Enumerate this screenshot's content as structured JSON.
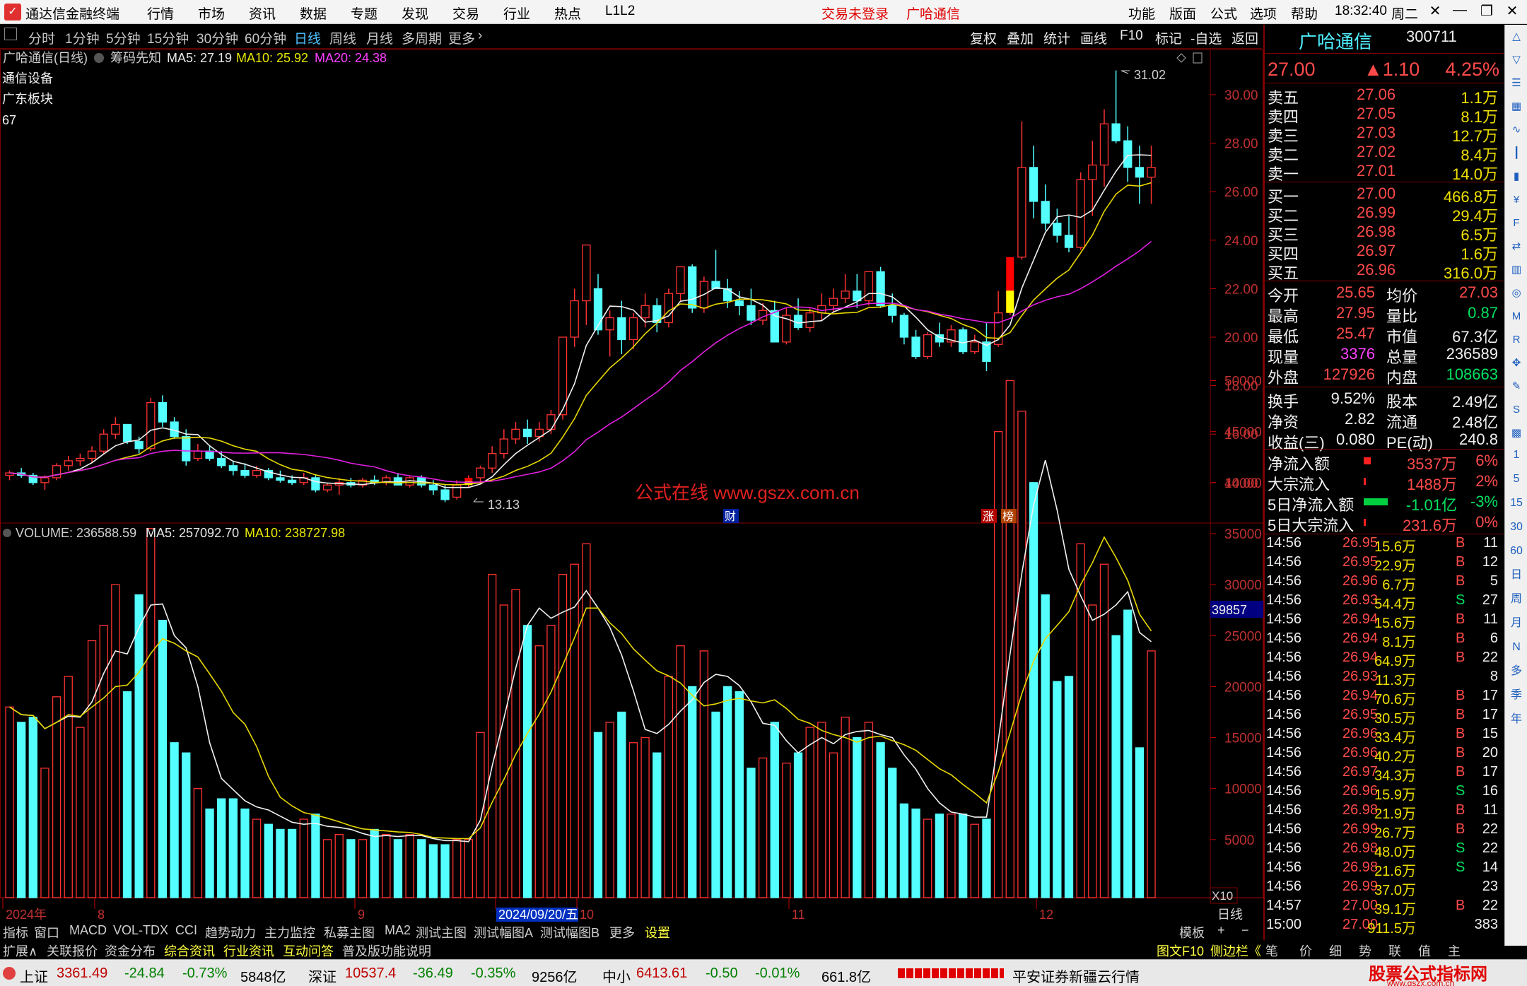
{
  "app": {
    "title": "通达信金融终端",
    "menus": [
      "行情",
      "市场",
      "资讯",
      "数据",
      "专题",
      "发现",
      "交易",
      "行业",
      "热点",
      "L1L2"
    ],
    "login": "交易未登录",
    "stock_tab": "广哈通信",
    "right_menus": [
      "功能",
      "版面",
      "公式",
      "选项",
      "帮助"
    ],
    "time": "18:32:40",
    "weekday": "周二"
  },
  "periods": [
    "分时",
    "1分钟",
    "5分钟",
    "15分钟",
    "30分钟",
    "60分钟",
    "日线",
    "周线",
    "月线",
    "多周期",
    "更多"
  ],
  "active_period": "日线",
  "tools": [
    "复权",
    "叠加",
    "统计",
    "画线",
    "F10",
    "标记",
    "-自选",
    "返回"
  ],
  "chart": {
    "title": "广哈通信(日线)",
    "chip": "筹码先知",
    "ma5": "MA5: 27.19",
    "ma10": "MA10: 25.92",
    "ma20": "MA20: 24.38",
    "info": [
      "通信设备",
      "广东板块",
      "67"
    ],
    "max_label": "31.02",
    "min_label": "13.13",
    "watermark": "公式在线 www.gszx.com.cn",
    "event_cai": "财",
    "event_zhang": "涨",
    "event_bang": "榜",
    "price_ticks": [
      "30.00",
      "28.00",
      "26.00",
      "24.00",
      "22.00",
      "20.00",
      "18.00",
      "16.00",
      "14.00"
    ]
  },
  "volume": {
    "title": "VOLUME: 236588.59",
    "ma5": "MA5: 257092.70",
    "ma10": "MA10: 238727.98",
    "ticks": [
      "50000",
      "45000",
      "40000",
      "35000",
      "30000",
      "25000",
      "20000",
      "15000",
      "10000",
      "5000"
    ],
    "cursor_value": "39857",
    "unit": "X10"
  },
  "xaxis": {
    "labels": [
      "2024年",
      "8",
      "9",
      "2024/09/20/五",
      "10",
      "11",
      "12"
    ],
    "period": "日线"
  },
  "chart_data": {
    "type": "candlestick",
    "series": [
      [
        14.3,
        14.5,
        14.1,
        14.4,
        18000
      ],
      [
        14.4,
        14.6,
        14.2,
        14.3,
        16500
      ],
      [
        14.3,
        14.4,
        13.9,
        14.0,
        17000
      ],
      [
        14.0,
        14.3,
        13.7,
        14.2,
        12000
      ],
      [
        14.2,
        14.8,
        14.1,
        14.7,
        19000
      ],
      [
        14.7,
        15.1,
        14.5,
        14.9,
        21000
      ],
      [
        14.9,
        15.2,
        14.7,
        15.0,
        16000
      ],
      [
        15.0,
        15.5,
        14.8,
        15.3,
        24500
      ],
      [
        15.3,
        16.2,
        15.2,
        16.0,
        26000
      ],
      [
        16.0,
        16.7,
        15.8,
        16.4,
        30000
      ],
      [
        16.4,
        16.1,
        15.6,
        15.7,
        19500
      ],
      [
        15.7,
        15.9,
        15.2,
        15.4,
        29000
      ],
      [
        15.4,
        17.5,
        15.3,
        17.3,
        35500
      ],
      [
        17.3,
        17.6,
        16.3,
        16.5,
        26500
      ],
      [
        16.5,
        16.7,
        15.8,
        15.9,
        14500
      ],
      [
        15.9,
        16.2,
        14.7,
        14.9,
        13500
      ],
      [
        15.0,
        15.6,
        14.9,
        15.3,
        10000
      ],
      [
        15.3,
        15.5,
        14.9,
        15.0,
        8000
      ],
      [
        15.0,
        15.3,
        14.6,
        14.7,
        9000
      ],
      [
        14.7,
        14.9,
        14.3,
        14.5,
        9000
      ],
      [
        14.5,
        14.8,
        14.2,
        14.3,
        8000
      ],
      [
        14.3,
        14.7,
        14.2,
        14.5,
        7000
      ],
      [
        14.5,
        14.6,
        14.1,
        14.2,
        6500
      ],
      [
        14.2,
        14.5,
        14.0,
        14.1,
        6000
      ],
      [
        14.1,
        14.3,
        13.9,
        14.0,
        6000
      ],
      [
        14.0,
        14.4,
        13.9,
        14.2,
        7000
      ],
      [
        14.2,
        14.3,
        13.6,
        13.7,
        7500
      ],
      [
        13.7,
        14.0,
        13.6,
        13.9,
        5000
      ],
      [
        13.9,
        14.2,
        13.5,
        14.0,
        5500
      ],
      [
        14.0,
        14.2,
        13.8,
        13.9,
        5000
      ],
      [
        13.9,
        14.2,
        13.8,
        14.1,
        5000
      ],
      [
        14.1,
        14.3,
        13.9,
        14.0,
        6000
      ],
      [
        14.0,
        14.3,
        13.9,
        14.2,
        5500
      ],
      [
        14.2,
        14.4,
        13.9,
        13.9,
        5000
      ],
      [
        13.9,
        14.3,
        13.8,
        14.2,
        5500
      ],
      [
        14.2,
        14.3,
        13.8,
        13.9,
        5000
      ],
      [
        13.9,
        14.1,
        13.5,
        13.7,
        4500
      ],
      [
        13.7,
        13.9,
        13.2,
        13.3,
        4500
      ],
      [
        13.4,
        14.1,
        13.3,
        13.9,
        5000
      ],
      [
        13.9,
        14.3,
        13.8,
        14.2,
        5000
      ],
      [
        14.2,
        14.7,
        14.0,
        14.6,
        15500
      ],
      [
        14.6,
        15.5,
        14.4,
        15.2,
        31000
      ],
      [
        15.2,
        16.2,
        15.0,
        15.8,
        28000
      ],
      [
        15.8,
        16.5,
        15.6,
        16.2,
        29500
      ],
      [
        16.2,
        16.6,
        15.6,
        15.9,
        26000
      ],
      [
        15.9,
        16.5,
        15.7,
        16.2,
        24000
      ],
      [
        16.2,
        17.0,
        16.0,
        16.8,
        26000
      ],
      [
        16.8,
        20.0,
        16.6,
        20.0,
        31000
      ],
      [
        20.0,
        22.0,
        19.6,
        21.5,
        32000
      ],
      [
        21.5,
        23.8,
        20.5,
        23.8,
        34000
      ],
      [
        22.0,
        22.6,
        20.1,
        20.3,
        15500
      ],
      [
        20.3,
        21.1,
        19.2,
        20.8,
        16500
      ],
      [
        20.8,
        21.5,
        19.3,
        19.9,
        17500
      ],
      [
        19.9,
        21.0,
        19.5,
        20.8,
        14500
      ],
      [
        20.8,
        21.8,
        20.4,
        21.3,
        15000
      ],
      [
        21.3,
        21.6,
        20.2,
        20.6,
        13500
      ],
      [
        20.6,
        22.0,
        20.4,
        21.8,
        21000
      ],
      [
        21.8,
        22.9,
        21.5,
        22.9,
        24000
      ],
      [
        22.9,
        23.0,
        21.0,
        21.2,
        20000
      ],
      [
        21.2,
        22.5,
        21.0,
        22.3,
        23500
      ],
      [
        22.3,
        23.6,
        22.0,
        22.0,
        17500
      ],
      [
        22.0,
        22.4,
        21.2,
        21.5,
        20000
      ],
      [
        21.5,
        21.9,
        20.9,
        21.3,
        19500
      ],
      [
        21.3,
        22.0,
        20.5,
        20.7,
        12000
      ],
      [
        20.7,
        21.4,
        20.5,
        21.1,
        13000
      ],
      [
        21.1,
        21.5,
        19.8,
        19.8,
        16500
      ],
      [
        19.8,
        21.2,
        19.7,
        20.9,
        12500
      ],
      [
        20.9,
        21.6,
        20.3,
        20.4,
        13500
      ],
      [
        20.4,
        21.2,
        20.2,
        21.0,
        16000
      ],
      [
        21.0,
        21.8,
        20.7,
        21.3,
        16500
      ],
      [
        21.3,
        22.0,
        21.0,
        21.6,
        13500
      ],
      [
        21.6,
        22.6,
        21.4,
        21.9,
        17000
      ],
      [
        21.9,
        22.6,
        21.2,
        21.5,
        15000
      ],
      [
        21.5,
        22.7,
        21.3,
        22.7,
        16500
      ],
      [
        22.7,
        22.9,
        21.2,
        21.3,
        14500
      ],
      [
        21.3,
        21.8,
        20.6,
        20.9,
        12000
      ],
      [
        20.9,
        21.0,
        19.7,
        20.0,
        8500
      ],
      [
        20.0,
        20.3,
        19.1,
        19.2,
        8000
      ],
      [
        19.2,
        20.2,
        19.1,
        20.1,
        7000
      ],
      [
        20.1,
        20.6,
        19.6,
        19.8,
        7500
      ],
      [
        19.8,
        20.5,
        19.6,
        20.3,
        7500
      ],
      [
        20.3,
        20.4,
        19.3,
        19.4,
        7500
      ],
      [
        19.4,
        20.1,
        19.3,
        19.8,
        6500
      ],
      [
        19.8,
        20.6,
        18.6,
        19.0,
        7000
      ],
      [
        19.7,
        21.9,
        19.6,
        21.0,
        45000
      ],
      [
        21.0,
        23.3,
        20.9,
        23.3,
        50000
      ],
      [
        23.3,
        28.9,
        23.2,
        27.0,
        47000
      ],
      [
        27.0,
        27.9,
        24.9,
        25.6,
        40000
      ],
      [
        25.6,
        26.3,
        24.4,
        24.7,
        29000
      ],
      [
        24.7,
        25.3,
        23.9,
        24.2,
        20500
      ],
      [
        24.2,
        25.0,
        23.5,
        23.7,
        21000
      ],
      [
        23.7,
        26.8,
        23.6,
        26.5,
        34000
      ],
      [
        26.5,
        28.1,
        25.0,
        27.1,
        28000
      ],
      [
        27.1,
        29.4,
        26.2,
        28.8,
        32000
      ],
      [
        28.8,
        31.0,
        28.0,
        28.1,
        25000
      ],
      [
        28.1,
        28.7,
        26.4,
        27.0,
        27500
      ],
      [
        27.0,
        27.9,
        25.5,
        26.6,
        14000
      ],
      [
        26.6,
        27.9,
        25.5,
        27.0,
        23500
      ]
    ]
  },
  "quote": {
    "name": "广哈通信",
    "code": "300711",
    "price": "27.00",
    "change": "▲1.10",
    "pct": "4.25%",
    "asks": [
      [
        "卖五",
        "27.06",
        "1.1万"
      ],
      [
        "卖四",
        "27.05",
        "8.1万"
      ],
      [
        "卖三",
        "27.03",
        "12.7万"
      ],
      [
        "卖二",
        "27.02",
        "8.4万"
      ],
      [
        "卖一",
        "27.01",
        "14.0万"
      ]
    ],
    "bids": [
      [
        "买一",
        "27.00",
        "466.8万"
      ],
      [
        "买二",
        "26.99",
        "29.4万"
      ],
      [
        "买三",
        "26.98",
        "6.5万"
      ],
      [
        "买四",
        "26.97",
        "1.6万"
      ],
      [
        "买五",
        "26.96",
        "316.0万"
      ]
    ],
    "stats": [
      [
        "今开",
        "25.65",
        "均价",
        "27.03"
      ],
      [
        "最高",
        "27.95",
        "量比",
        "0.87"
      ],
      [
        "最低",
        "25.47",
        "市值",
        "67.3亿"
      ],
      [
        "现量",
        "3376",
        "总量",
        "236589"
      ],
      [
        "外盘",
        "127926",
        "内盘",
        "108663"
      ]
    ],
    "stats2": [
      [
        "换手",
        "9.52%",
        "股本",
        "2.49亿"
      ],
      [
        "净资",
        "2.82",
        "流通",
        "2.48亿"
      ],
      [
        "收益(三)",
        "0.080",
        "PE(动)",
        "240.8"
      ]
    ],
    "flows": [
      [
        "净流入额",
        "3537万",
        "6%"
      ],
      [
        "大宗流入",
        "1488万",
        "2%"
      ],
      [
        "5日净流入额",
        "-1.01亿",
        "-3%"
      ],
      [
        "5日大宗流入",
        "231.6万",
        "0%"
      ]
    ],
    "ticks": [
      [
        "14:56",
        "26.95",
        "15.6万",
        "B",
        "11"
      ],
      [
        "14:56",
        "26.95",
        "22.9万",
        "B",
        "12"
      ],
      [
        "14:56",
        "26.96",
        "6.7万",
        "B",
        "5"
      ],
      [
        "14:56",
        "26.93",
        "54.4万",
        "S",
        "27"
      ],
      [
        "14:56",
        "26.94",
        "15.6万",
        "B",
        "11"
      ],
      [
        "14:56",
        "26.94",
        "8.1万",
        "B",
        "6"
      ],
      [
        "14:56",
        "26.94",
        "64.9万",
        "B",
        "22"
      ],
      [
        "14:56",
        "26.93",
        "11.3万",
        "",
        "8"
      ],
      [
        "14:56",
        "26.94",
        "70.6万",
        "B",
        "17"
      ],
      [
        "14:56",
        "26.95",
        "30.5万",
        "B",
        "17"
      ],
      [
        "14:56",
        "26.96",
        "33.4万",
        "B",
        "15"
      ],
      [
        "14:56",
        "26.96",
        "40.2万",
        "B",
        "20"
      ],
      [
        "14:56",
        "26.97",
        "34.3万",
        "B",
        "17"
      ],
      [
        "14:56",
        "26.96",
        "15.9万",
        "S",
        "16"
      ],
      [
        "14:56",
        "26.98",
        "21.9万",
        "B",
        "11"
      ],
      [
        "14:56",
        "26.99",
        "26.7万",
        "B",
        "22"
      ],
      [
        "14:56",
        "26.98",
        "48.0万",
        "S",
        "22"
      ],
      [
        "14:56",
        "26.98",
        "21.6万",
        "S",
        "14"
      ],
      [
        "14:56",
        "26.99",
        "37.0万",
        "",
        "23"
      ],
      [
        "14:57",
        "27.00",
        "39.1万",
        "B",
        "22"
      ],
      [
        "15:00",
        "27.00",
        "911.5万",
        "",
        "383"
      ]
    ]
  },
  "bottom_tabs": [
    "指标",
    "窗口",
    "MACD",
    "VOL-TDX",
    "CCI",
    "趋势动力",
    "主力监控",
    "私募主图",
    "MA2",
    "测试主图",
    "测试幅图A",
    "测试幅图B",
    "更多",
    "设置"
  ],
  "bottom_right": [
    "模板",
    "+",
    "−"
  ],
  "bottom_tabs2": [
    "扩展∧",
    "关联报价",
    "资金分布",
    "综合资讯",
    "行业资讯",
    "互动问答",
    "普及版功能说明"
  ],
  "bottom_tabs2_right": [
    "图文F10",
    "侧边栏《",
    "笔",
    "价",
    "细",
    "势",
    "联",
    "值",
    "主"
  ],
  "status": {
    "sh": "上证",
    "sh_val": "3361.49",
    "sh_chg": "-24.84",
    "sh_pct": "-0.73%",
    "sh_amt": "5848亿",
    "sz": "深证",
    "sz_val": "10537.4",
    "sz_chg": "-36.49",
    "sz_pct": "-0.35%",
    "sz_amt": "9256亿",
    "zx": "中小",
    "zx_val": "6413.61",
    "zx_chg": "-0.50",
    "zx_pct": "-0.01%",
    "zx_amt": "661.8亿",
    "broker": "平安证券新疆云行情",
    "brand": "股票公式指标网",
    "brand_url": "www.gszx.com.cn"
  },
  "sidebar_icons": [
    "up-icon",
    "down-icon",
    "list-icon",
    "grid-icon",
    "chart-icon",
    "candle-icon",
    "bar-icon",
    "fund-icon",
    "f10-icon",
    "compare-icon",
    "vol-icon",
    "circle-icon",
    "macd-icon",
    "rsi-icon",
    "dir-icon",
    "pen-icon",
    "fs-icon",
    "grid2-icon"
  ],
  "sidebar_labels": [
    "1",
    "5",
    "15",
    "30",
    "60",
    "日",
    "周",
    "月",
    "N",
    "多",
    "季",
    "年"
  ]
}
